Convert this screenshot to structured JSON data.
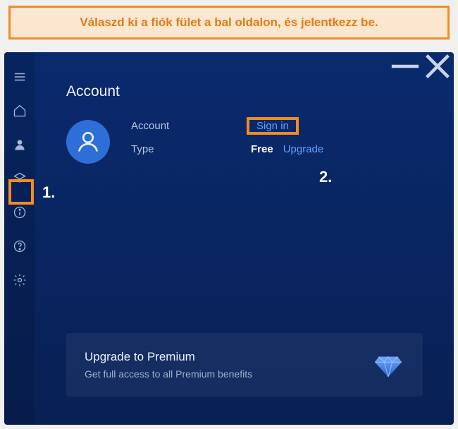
{
  "instruction": "Válaszd ki a fiók fület a bal oldalon, és jelentkezz be.",
  "steps": {
    "one": "1.",
    "two": "2."
  },
  "page": {
    "title": "Account"
  },
  "account": {
    "field_account_label": "Account",
    "signin_label": "Sign in",
    "field_type_label": "Type",
    "type_value": "Free",
    "upgrade_label": "Upgrade"
  },
  "premium": {
    "title": "Upgrade to Premium",
    "subtitle": "Get full access to all Premium benefits"
  },
  "colors": {
    "highlight": "#f28c1f",
    "link": "#5fa0ff",
    "bg_top": "#0a2a6e",
    "bg_bottom": "#082054"
  }
}
